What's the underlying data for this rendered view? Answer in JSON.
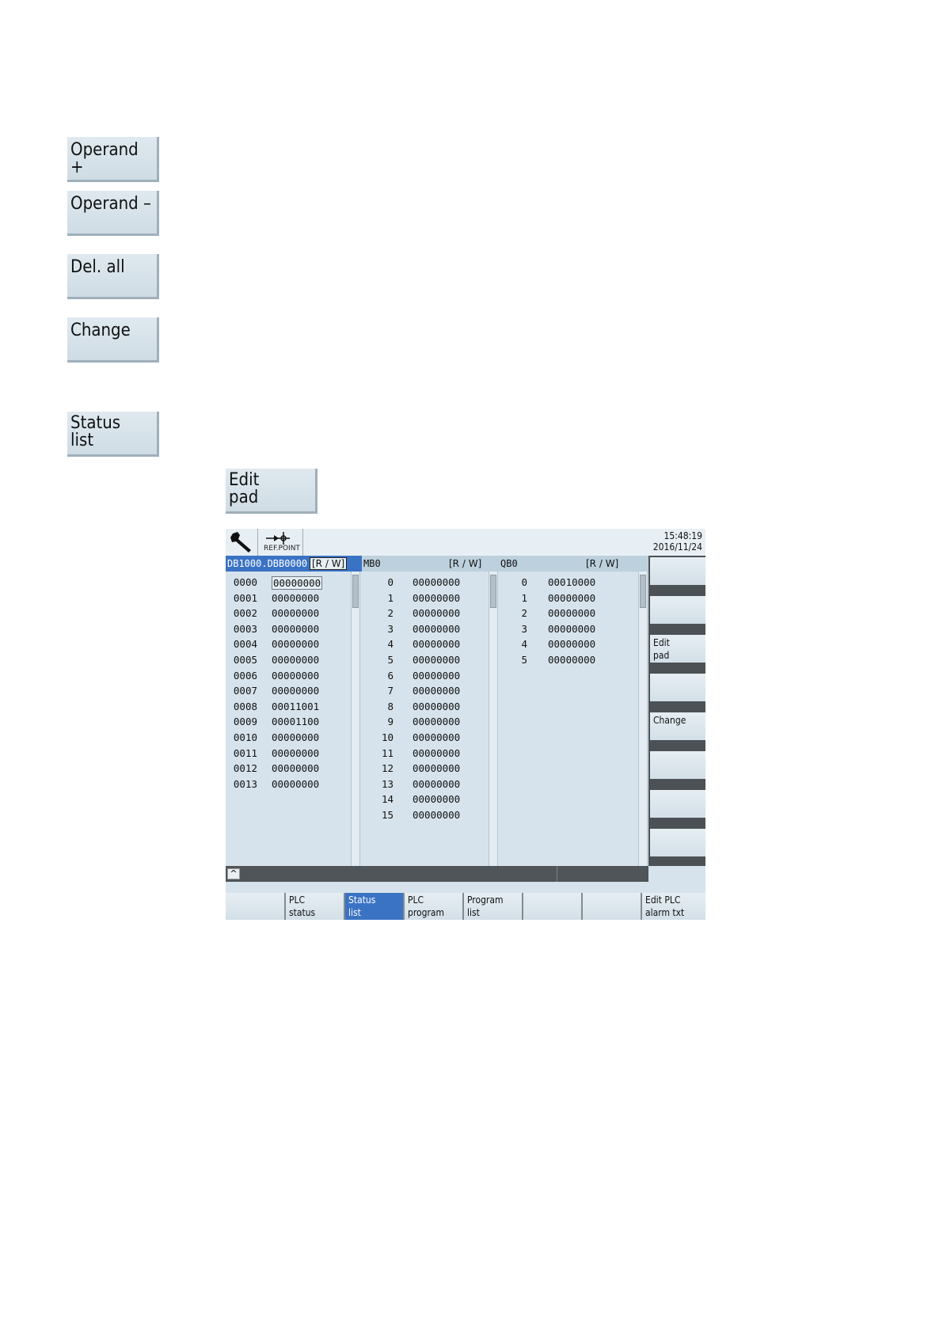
{
  "buttons": {
    "operand_plus": "Operand +",
    "operand_minus": "Operand –",
    "del_all": "Del. all",
    "change": "Change",
    "status_list": "Status\nlist",
    "edit_pad": "Edit\npad"
  },
  "screen": {
    "header": {
      "refpoint_label": "REF.POINT",
      "time": "15:48:19",
      "date": "2016/11/24"
    },
    "columns": [
      {
        "title": "DB1000.DBB0000",
        "mode": "[R / W]",
        "rows": [
          {
            "addr": "0000",
            "value": "00000000"
          },
          {
            "addr": "0001",
            "value": "00000000"
          },
          {
            "addr": "0002",
            "value": "00000000"
          },
          {
            "addr": "0003",
            "value": "00000000"
          },
          {
            "addr": "0004",
            "value": "00000000"
          },
          {
            "addr": "0005",
            "value": "00000000"
          },
          {
            "addr": "0006",
            "value": "00000000"
          },
          {
            "addr": "0007",
            "value": "00000000"
          },
          {
            "addr": "0008",
            "value": "00011001"
          },
          {
            "addr": "0009",
            "value": "00001100"
          },
          {
            "addr": "0010",
            "value": "00000000"
          },
          {
            "addr": "0011",
            "value": "00000000"
          },
          {
            "addr": "0012",
            "value": "00000000"
          },
          {
            "addr": "0013",
            "value": "00000000"
          }
        ]
      },
      {
        "title": "MB0",
        "mode": "[R / W]",
        "rows": [
          {
            "addr": "0",
            "value": "00000000"
          },
          {
            "addr": "1",
            "value": "00000000"
          },
          {
            "addr": "2",
            "value": "00000000"
          },
          {
            "addr": "3",
            "value": "00000000"
          },
          {
            "addr": "4",
            "value": "00000000"
          },
          {
            "addr": "5",
            "value": "00000000"
          },
          {
            "addr": "6",
            "value": "00000000"
          },
          {
            "addr": "7",
            "value": "00000000"
          },
          {
            "addr": "8",
            "value": "00000000"
          },
          {
            "addr": "9",
            "value": "00000000"
          },
          {
            "addr": "10",
            "value": "00000000"
          },
          {
            "addr": "11",
            "value": "00000000"
          },
          {
            "addr": "12",
            "value": "00000000"
          },
          {
            "addr": "13",
            "value": "00000000"
          },
          {
            "addr": "14",
            "value": "00000000"
          },
          {
            "addr": "15",
            "value": "00000000"
          }
        ]
      },
      {
        "title": "QB0",
        "mode": "[R / W]",
        "rows": [
          {
            "addr": "0",
            "value": "00010000"
          },
          {
            "addr": "1",
            "value": "00000000"
          },
          {
            "addr": "2",
            "value": "00000000"
          },
          {
            "addr": "3",
            "value": "00000000"
          },
          {
            "addr": "4",
            "value": "00000000"
          },
          {
            "addr": "5",
            "value": "00000000"
          }
        ]
      }
    ],
    "vertical_softkeys": [
      "",
      "",
      "Edit\npad",
      "",
      "Change",
      "",
      "",
      ""
    ],
    "horizontal_softkeys": [
      "",
      "PLC\nstatus",
      "Status\nlist",
      "PLC\nprogram",
      "Program\nlist",
      "",
      "",
      "Edit PLC\nalarm txt"
    ],
    "active_horizontal_index": 2,
    "up_arrow": "^"
  },
  "colors": {
    "screen_bg": "#d6e3ec",
    "active_blue": "#3b73c4",
    "bar_dark": "#4b5154"
  }
}
